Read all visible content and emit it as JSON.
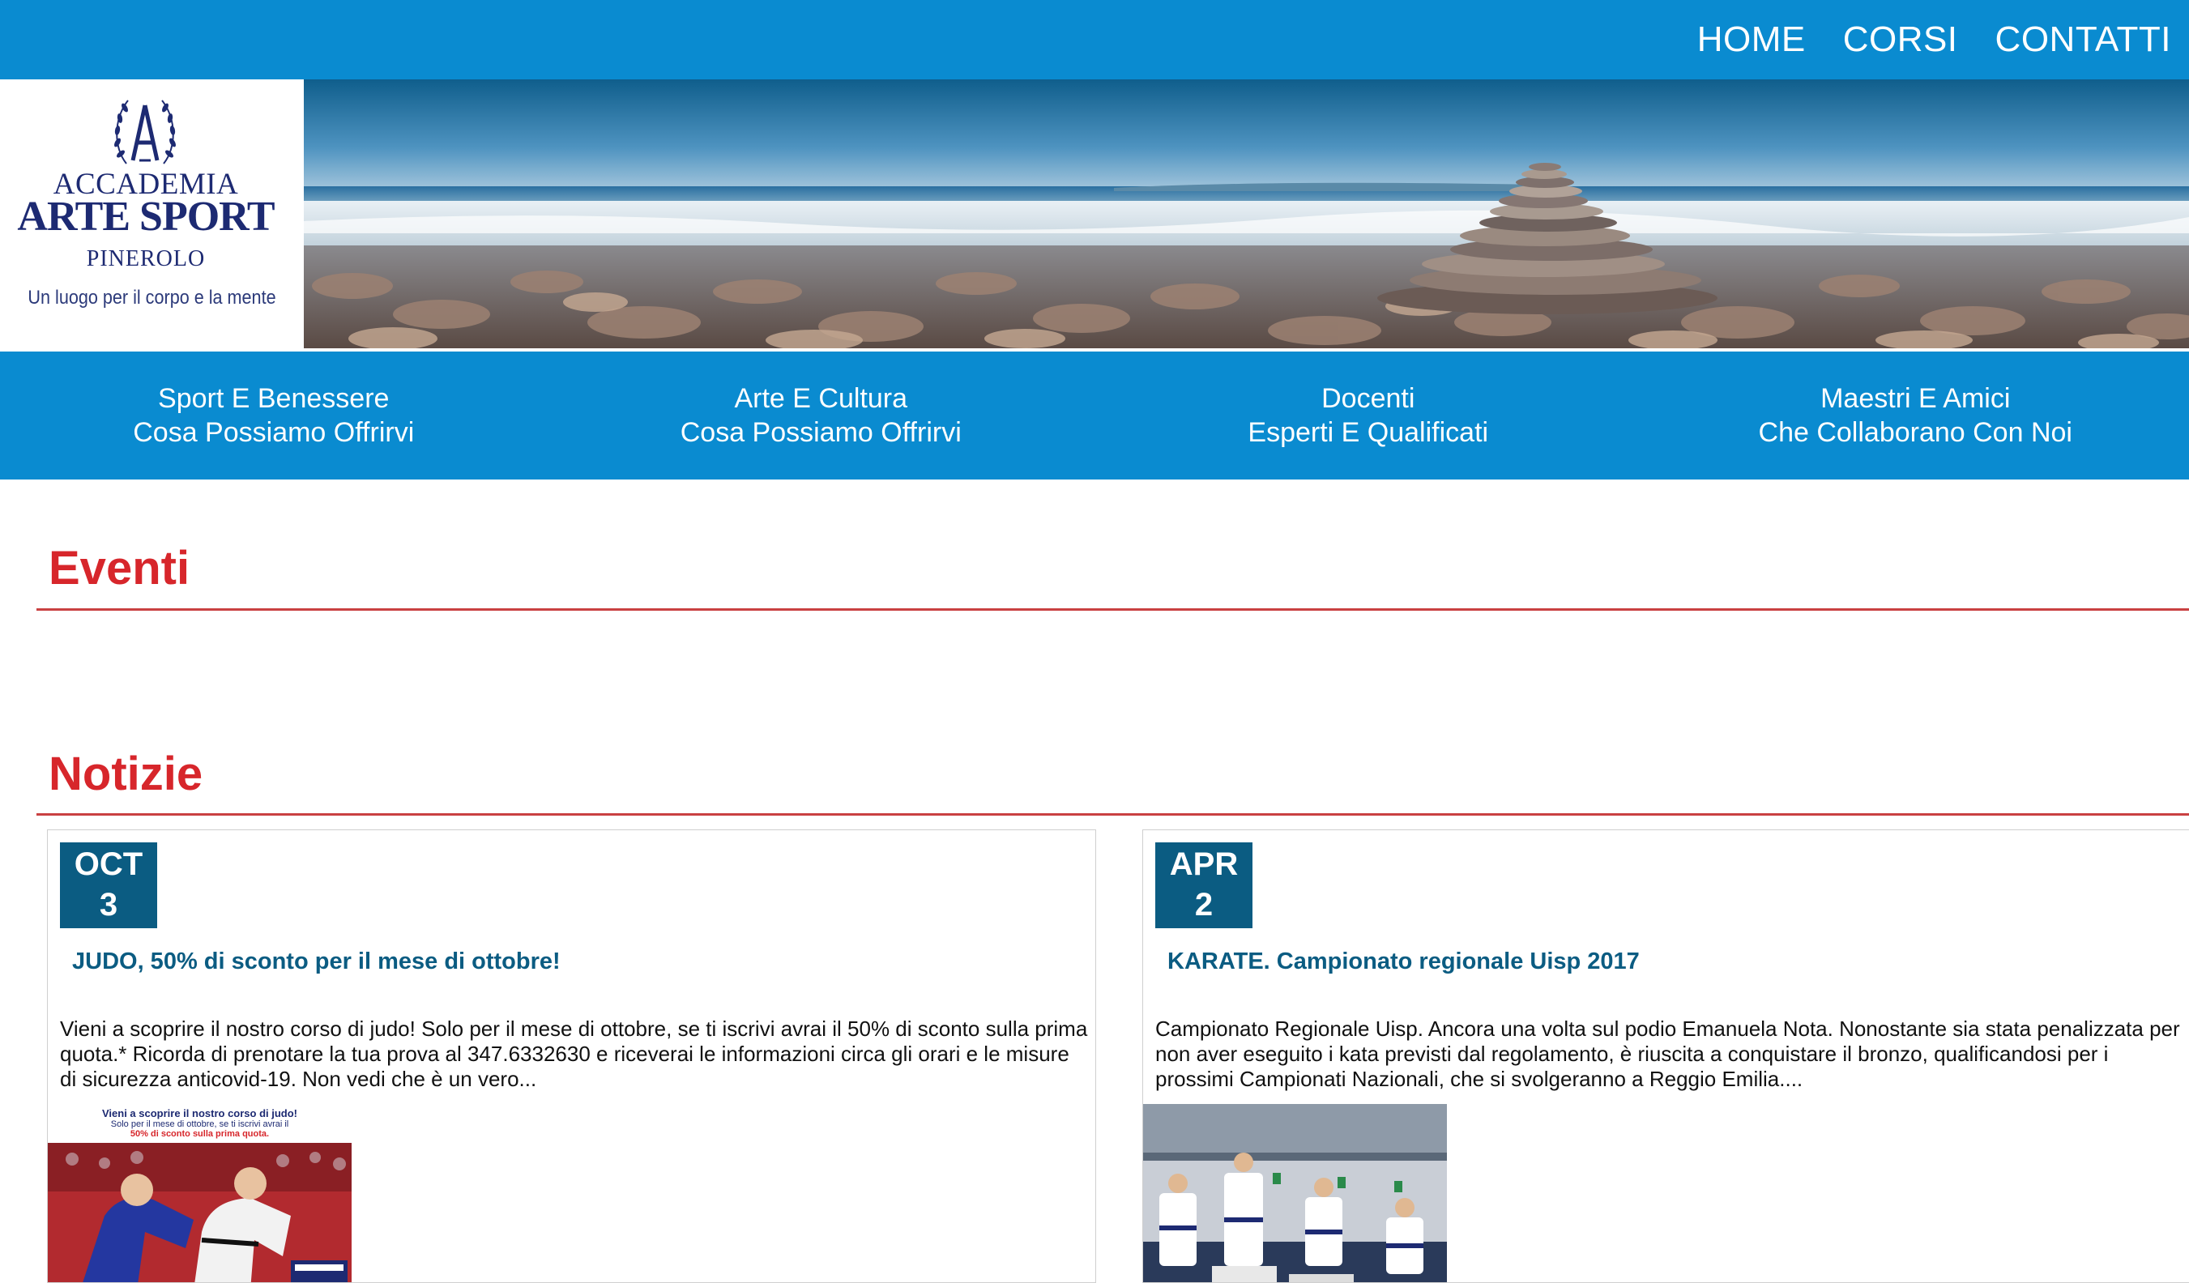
{
  "nav": {
    "items": [
      "HOME",
      "CORSI",
      "CONTATTI"
    ]
  },
  "logo": {
    "line1": "ACCADEMIA",
    "line2": "ARTE SPORT",
    "line3": "PINEROLO",
    "tagline": "Un luogo per il corpo e la mente"
  },
  "categories": [
    {
      "line1": "Sport E Benessere",
      "line2": "Cosa Possiamo Offrirvi"
    },
    {
      "line1": "Arte E Cultura",
      "line2": "Cosa Possiamo Offrirvi"
    },
    {
      "line1": "Docenti",
      "line2": "Esperti E Qualificati"
    },
    {
      "line1": "Maestri E Amici",
      "line2": "Che Collaborano Con Noi"
    }
  ],
  "sections": {
    "events": "Eventi",
    "news": "Notizie"
  },
  "news": [
    {
      "month": "OCT",
      "day": "3",
      "title": "JUDO, 50% di sconto per il mese di ottobre!",
      "body": "Vieni a scoprire il nostro corso di judo! Solo per il mese di ottobre, se ti iscrivi avrai il 50% di sconto sulla prima quota.* Ricorda di prenotare la tua prova al 347.6332630 e riceverai le informazioni circa gli orari e le misure di sicurezza anticovid-19. Non vedi che è un vero...",
      "image_caption_1": "Vieni a scoprire il nostro corso di judo!",
      "image_caption_2": "Solo per il mese di ottobre, se ti iscrivi avrai il",
      "image_caption_3": "50% di sconto sulla prima quota."
    },
    {
      "month": "APR",
      "day": "2",
      "title": "KARATE. Campionato regionale Uisp 2017",
      "body": "Campionato Regionale Uisp. Ancora una volta sul podio Emanuela Nota. Nonostante sia stata penalizzata per non aver eseguito i kata previsti dal regolamento, è riuscita a conquistare il bronzo, qualificandosi per i prossimi Campionati Nazionali, che si svolgeranno a Reggio Emilia...."
    }
  ],
  "colors": {
    "nav_blue": "#0a8bd0",
    "date_blue": "#0b5c82",
    "section_red": "#d7262b",
    "logo_navy": "#1d2a72"
  }
}
